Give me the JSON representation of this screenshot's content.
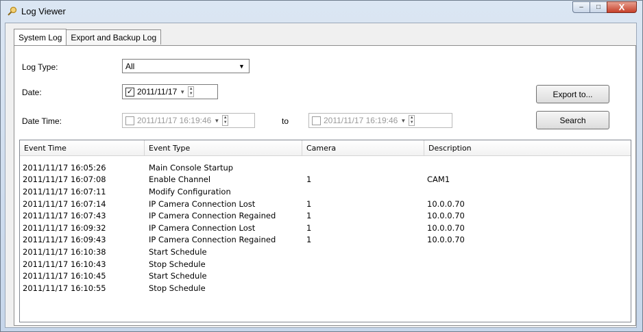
{
  "window": {
    "title": "Log Viewer",
    "icon": "magnifier-icon",
    "controls": {
      "minimize": "–",
      "maximize": "□",
      "close": "X"
    }
  },
  "tabs": [
    {
      "label": "System Log",
      "active": true
    },
    {
      "label": "Export and Backup Log",
      "active": false
    }
  ],
  "filters": {
    "log_type_label": "Log Type:",
    "log_type_value": "All",
    "date_label": "Date:",
    "date_checked": true,
    "date_value": "2011/11/17",
    "datetime_label": "Date Time:",
    "datetime_from": "2011/11/17 16:19:46",
    "to_label": "to",
    "datetime_to": "2011/11/17 16:19:46"
  },
  "buttons": {
    "export": "Export to...",
    "search": "Search"
  },
  "table": {
    "columns": [
      "Event Time",
      "Event Type",
      "Camera",
      "Description"
    ],
    "rows": [
      [
        "2011/11/17 16:05:26",
        "Main Console Startup",
        "",
        ""
      ],
      [
        "2011/11/17 16:07:08",
        "Enable Channel",
        "1",
        "CAM1"
      ],
      [
        "2011/11/17 16:07:11",
        "Modify Configuration",
        "",
        ""
      ],
      [
        "2011/11/17 16:07:14",
        "IP Camera Connection Lost",
        "1",
        "10.0.0.70"
      ],
      [
        "2011/11/17 16:07:43",
        "IP Camera Connection Regained",
        "1",
        "10.0.0.70"
      ],
      [
        "2011/11/17 16:09:32",
        "IP Camera Connection Lost",
        "1",
        "10.0.0.70"
      ],
      [
        "2011/11/17 16:09:43",
        "IP Camera Connection Regained",
        "1",
        "10.0.0.70"
      ],
      [
        "2011/11/17 16:10:38",
        "Start Schedule",
        "",
        ""
      ],
      [
        "2011/11/17 16:10:43",
        "Stop Schedule",
        "",
        ""
      ],
      [
        "2011/11/17 16:10:45",
        "Start Schedule",
        "",
        ""
      ],
      [
        "2011/11/17 16:10:55",
        "Stop Schedule",
        "",
        ""
      ]
    ]
  },
  "colors": {
    "title_gradient": "#c6d6ea",
    "close_button": "#c6402a",
    "panel_bg": "#ffffff"
  }
}
